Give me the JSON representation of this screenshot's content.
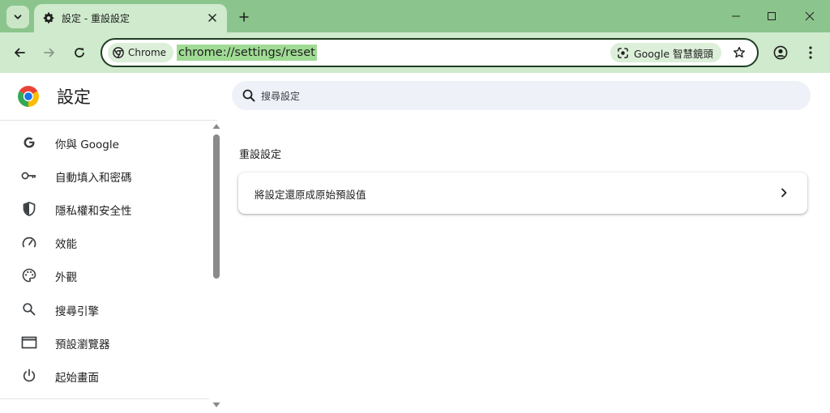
{
  "titlebar": {
    "tab_title": "設定 - 重設設定",
    "colors": {
      "frame": "#8bc58d",
      "tab": "#cfeacc"
    }
  },
  "toolbar": {
    "site_chip_label": "Chrome",
    "url": "chrome://settings/reset",
    "lens_label": "Google 智慧鏡頭"
  },
  "settings": {
    "title": "設定",
    "search_placeholder": "搜尋設定",
    "nav_items": [
      {
        "label": "你與 Google",
        "icon": "google-g-icon"
      },
      {
        "label": "自動填入和密碼",
        "icon": "key-icon"
      },
      {
        "label": "隱私權和安全性",
        "icon": "shield-icon"
      },
      {
        "label": "效能",
        "icon": "speedometer-icon"
      },
      {
        "label": "外觀",
        "icon": "palette-icon"
      },
      {
        "label": "搜尋引擎",
        "icon": "search-icon"
      },
      {
        "label": "預設瀏覽器",
        "icon": "browser-window-icon"
      },
      {
        "label": "起始畫面",
        "icon": "power-icon"
      }
    ],
    "section_title": "重設設定",
    "reset_row_label": "將設定還原成原始預設值"
  }
}
